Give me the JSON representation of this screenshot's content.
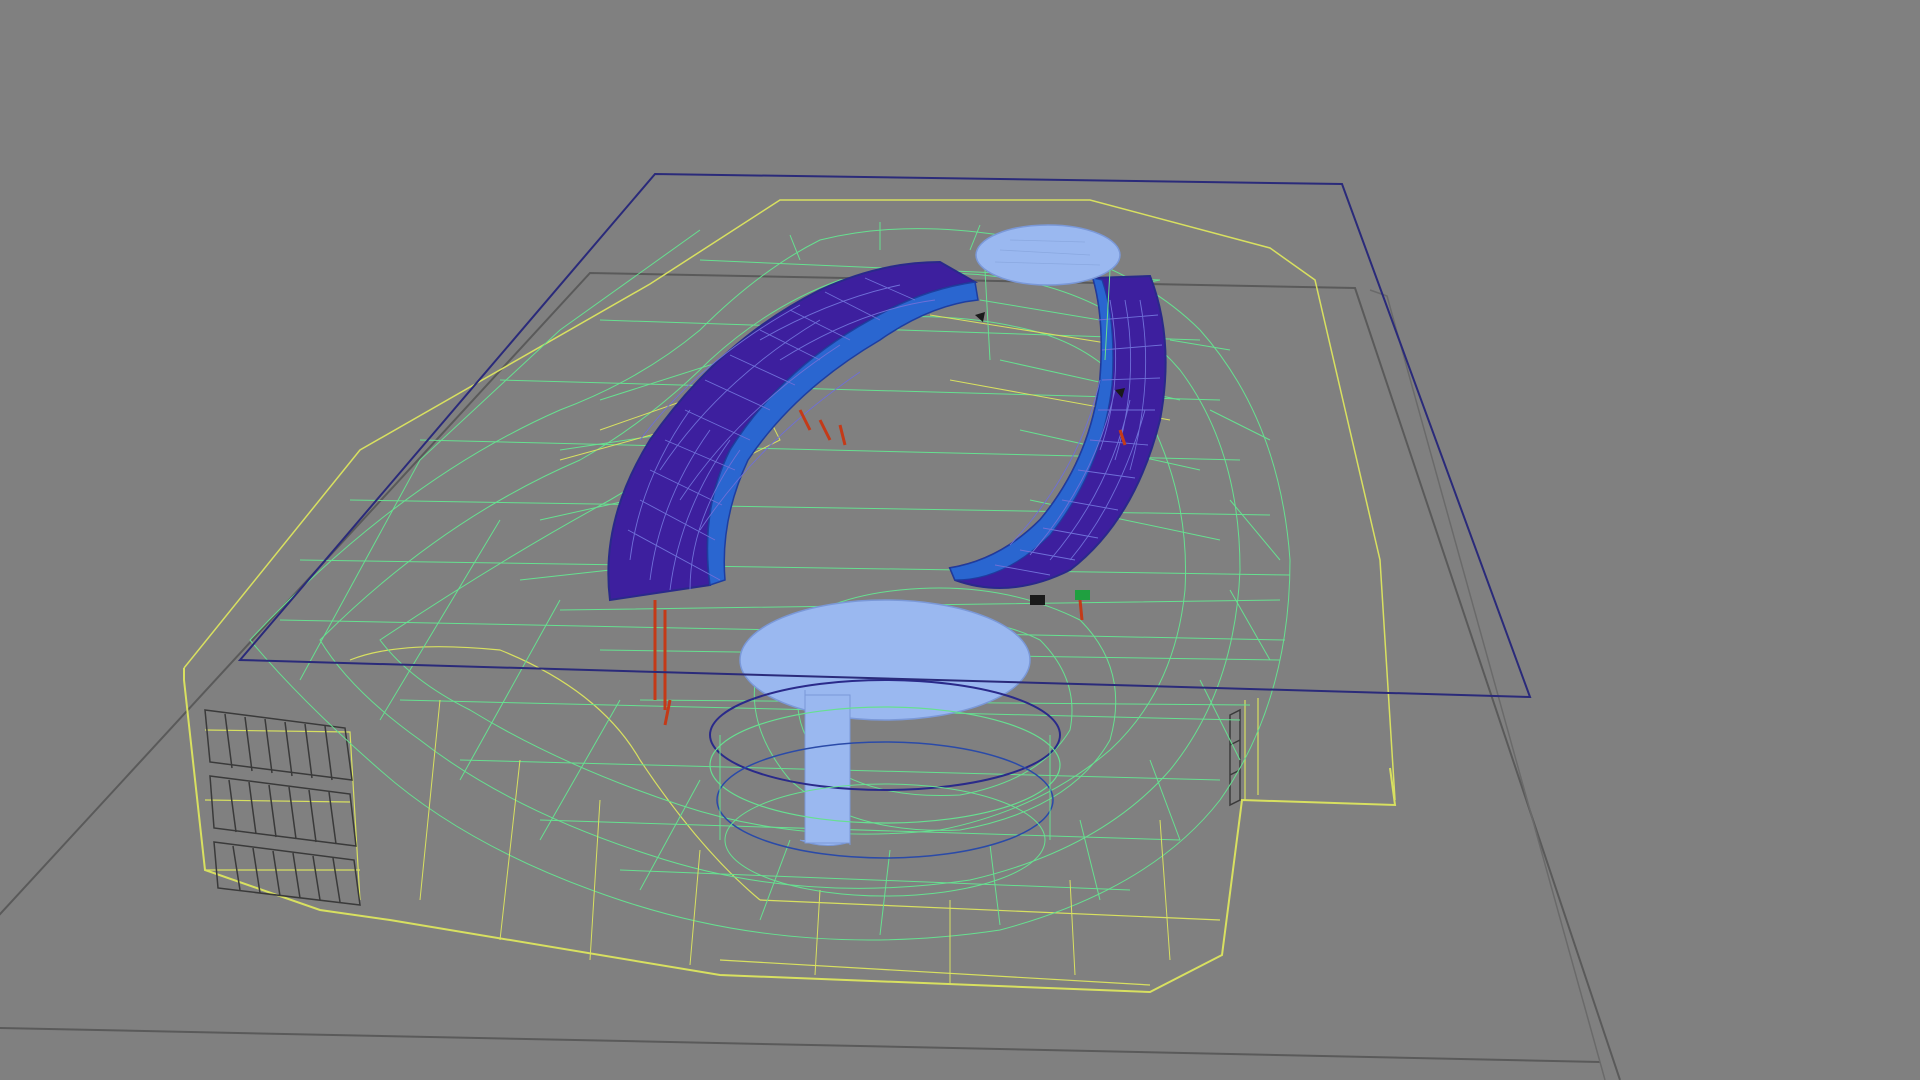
{
  "viewport": {
    "background": "#808080",
    "view_type": "perspective",
    "render_mode": "wireframe"
  },
  "scene": {
    "ground_plane_color": "#595959",
    "section_plane_color": "#2a2a7a",
    "edges_color": "#66e090",
    "outline_color": "#d8e060",
    "roof_color": "#3d1f9e",
    "roof_frame_color": "#2a66d0",
    "dome_color": "#9ab8f0",
    "column_color": "#c43a18",
    "glass_grid_color": "#3a3a3a"
  }
}
